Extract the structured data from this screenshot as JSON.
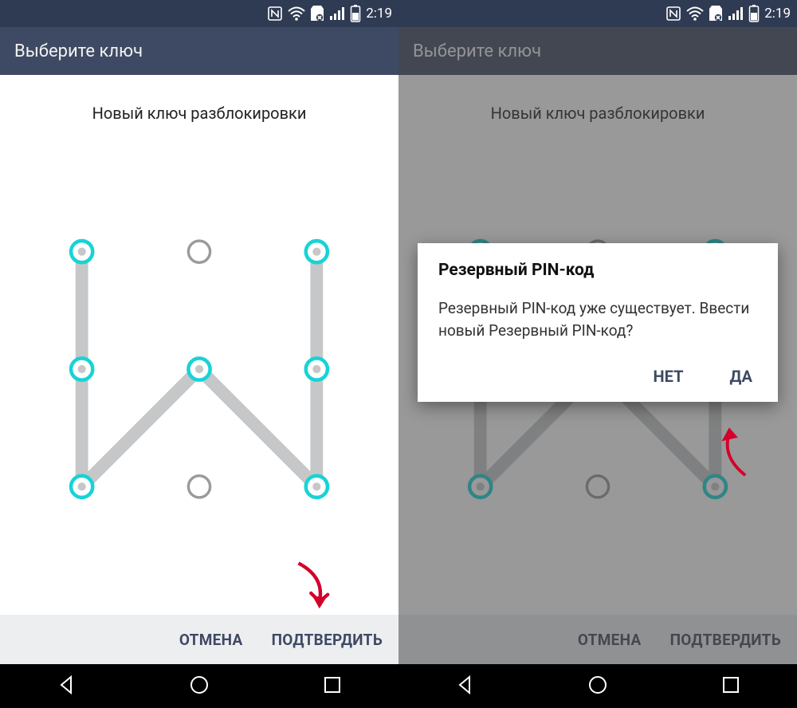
{
  "status": {
    "time": "2:19"
  },
  "screen": {
    "title": "Выберите ключ",
    "subtitle": "Новый ключ разблокировки"
  },
  "pattern": {
    "dots": 9,
    "active": [
      0,
      2,
      3,
      4,
      5,
      6,
      8
    ],
    "path": [
      0,
      6,
      4,
      8,
      2
    ]
  },
  "footer": {
    "cancel": "ОТМЕНА",
    "confirm": "ПОДТВЕРДИТЬ"
  },
  "dialog": {
    "title": "Резервный PIN-код",
    "body": "Резервный PIN-код уже существует. Ввести новый Резервный PIN-код?",
    "no": "НЕТ",
    "yes": "ДА"
  },
  "colors": {
    "accent": "#17d3d6",
    "line": "#c6c7c9",
    "header": "#3e4a63",
    "arrow": "#d4002a"
  }
}
